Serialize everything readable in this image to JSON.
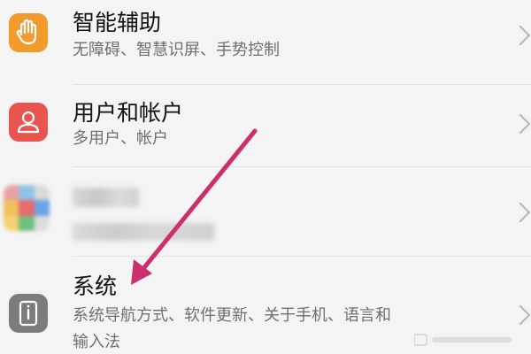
{
  "settings": {
    "items": [
      {
        "title": "智能辅助",
        "subtitle": "无障碍、智慧识屏、手势控制",
        "icon": "hand-icon",
        "icon_color": "#f39a2c"
      },
      {
        "title": "用户和帐户",
        "subtitle": "多用户、帐户",
        "icon": "user-icon",
        "icon_color": "#e85450"
      },
      {
        "title": "",
        "subtitle": "",
        "icon": "blurred-app-icon",
        "icon_color": "#4b8bf0"
      },
      {
        "title": "系统",
        "subtitle_line1": "系统导航方式、软件更新、关于手机、语言和",
        "subtitle_line2": "输入法",
        "icon": "phone-info-icon",
        "icon_color": "#7c7c7c"
      }
    ]
  },
  "annotation": {
    "arrow_color": "#cc2f6e"
  },
  "colors": {
    "background": "#f4f4f4",
    "title_text": "#111111",
    "subtitle_text": "#6f6f6f"
  }
}
